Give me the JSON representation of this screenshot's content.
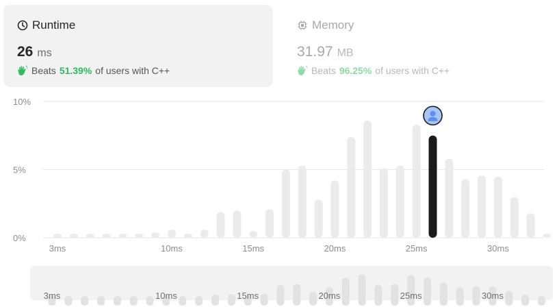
{
  "runtime": {
    "label": "Runtime",
    "value": "26",
    "unit": "ms",
    "beats_prefix": "Beats",
    "beats_pct": "51.39%",
    "beats_suffix": "of users with C++",
    "icon": "clock-icon"
  },
  "memory": {
    "label": "Memory",
    "value": "31.97",
    "unit": "MB",
    "beats_prefix": "Beats",
    "beats_pct": "96.25%",
    "beats_suffix": "of users with C++",
    "icon": "chip-icon"
  },
  "colors": {
    "accent_green": "#2cbb5d",
    "bar_gray": "#ebebeb",
    "bar_highlight": "#1a1a1a",
    "avatar_blue": "#5b8ff0"
  },
  "chart_data": {
    "type": "bar",
    "title": "",
    "xlabel": "",
    "ylabel": "",
    "ylim": [
      0,
      10
    ],
    "y_ticks": [
      "0%",
      "5%",
      "10%"
    ],
    "x_tick_labels": [
      "3ms",
      "10ms",
      "15ms",
      "20ms",
      "25ms",
      "30ms"
    ],
    "x_tick_positions_ms": [
      3,
      10,
      15,
      20,
      25,
      30
    ],
    "x": [
      3,
      4,
      5,
      6,
      7,
      8,
      9,
      10,
      11,
      12,
      13,
      14,
      15,
      16,
      17,
      18,
      19,
      20,
      21,
      22,
      23,
      24,
      25,
      26,
      27,
      28,
      29,
      30,
      31,
      32,
      33
    ],
    "values": [
      0.3,
      0.3,
      0.3,
      0.3,
      0.3,
      0.3,
      0.4,
      0.6,
      0.3,
      0.6,
      1.9,
      2.0,
      0.5,
      2.1,
      5.0,
      5.3,
      2.8,
      4.2,
      7.4,
      8.6,
      5.1,
      5.3,
      8.3,
      7.5,
      5.8,
      4.3,
      4.6,
      4.5,
      3.0,
      1.8,
      0.3
    ],
    "highlight_x": 26,
    "grid": true,
    "legend": "none"
  },
  "mini_chart": {
    "x_tick_labels": [
      "3ms",
      "10ms",
      "15ms",
      "20ms",
      "25ms",
      "30ms"
    ]
  }
}
